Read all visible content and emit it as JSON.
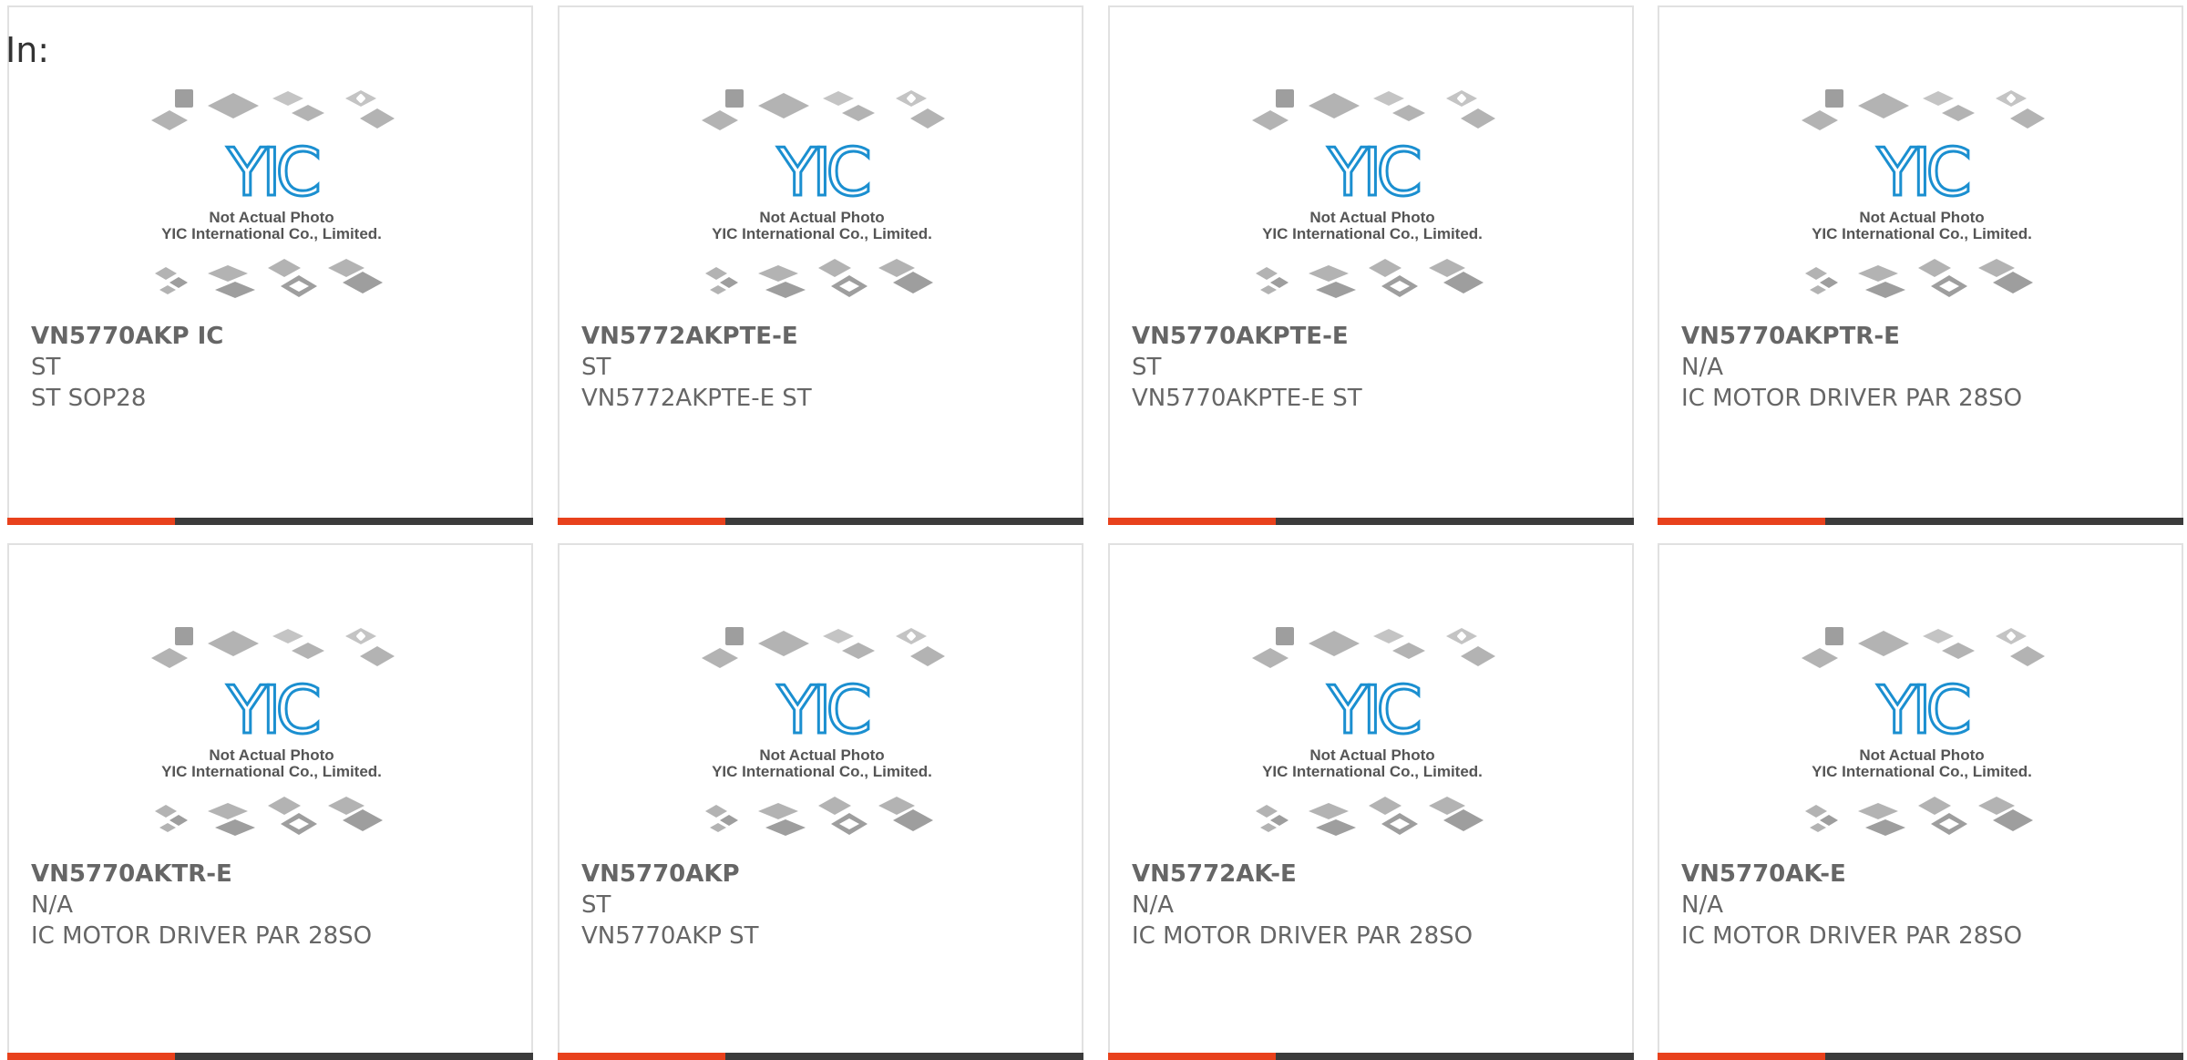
{
  "header": {
    "label": "In:"
  },
  "placeholder_image": {
    "caption_line1": "Not Actual Photo",
    "caption_line2": "YIC International Co., Limited.",
    "logo_text": "YIC",
    "icon": "ic-chip-placeholder-icon"
  },
  "colors": {
    "accent": "#e8411c",
    "bar_dark": "#3b3b3b",
    "text": "#666666",
    "logo_blue": "#1b8fd0",
    "border": "#e1e1e1"
  },
  "products": [
    {
      "part_number": "VN5770AKP IC",
      "manufacturer": "ST",
      "description": "ST SOP28"
    },
    {
      "part_number": "VN5772AKPTE-E",
      "manufacturer": "ST",
      "description": "VN5772AKPTE-E ST"
    },
    {
      "part_number": "VN5770AKPTE-E",
      "manufacturer": "ST",
      "description": "VN5770AKPTE-E ST"
    },
    {
      "part_number": "VN5770AKPTR-E",
      "manufacturer": "N/A",
      "description": "IC MOTOR DRIVER PAR 28SO"
    },
    {
      "part_number": "VN5770AKTR-E",
      "manufacturer": "N/A",
      "description": "IC MOTOR DRIVER PAR 28SO"
    },
    {
      "part_number": "VN5770AKP",
      "manufacturer": "ST",
      "description": "VN5770AKP ST"
    },
    {
      "part_number": "VN5772AK-E",
      "manufacturer": "N/A",
      "description": "IC MOTOR DRIVER PAR 28SO"
    },
    {
      "part_number": "VN5770AK-E",
      "manufacturer": "N/A",
      "description": "IC MOTOR DRIVER PAR 28SO"
    }
  ]
}
